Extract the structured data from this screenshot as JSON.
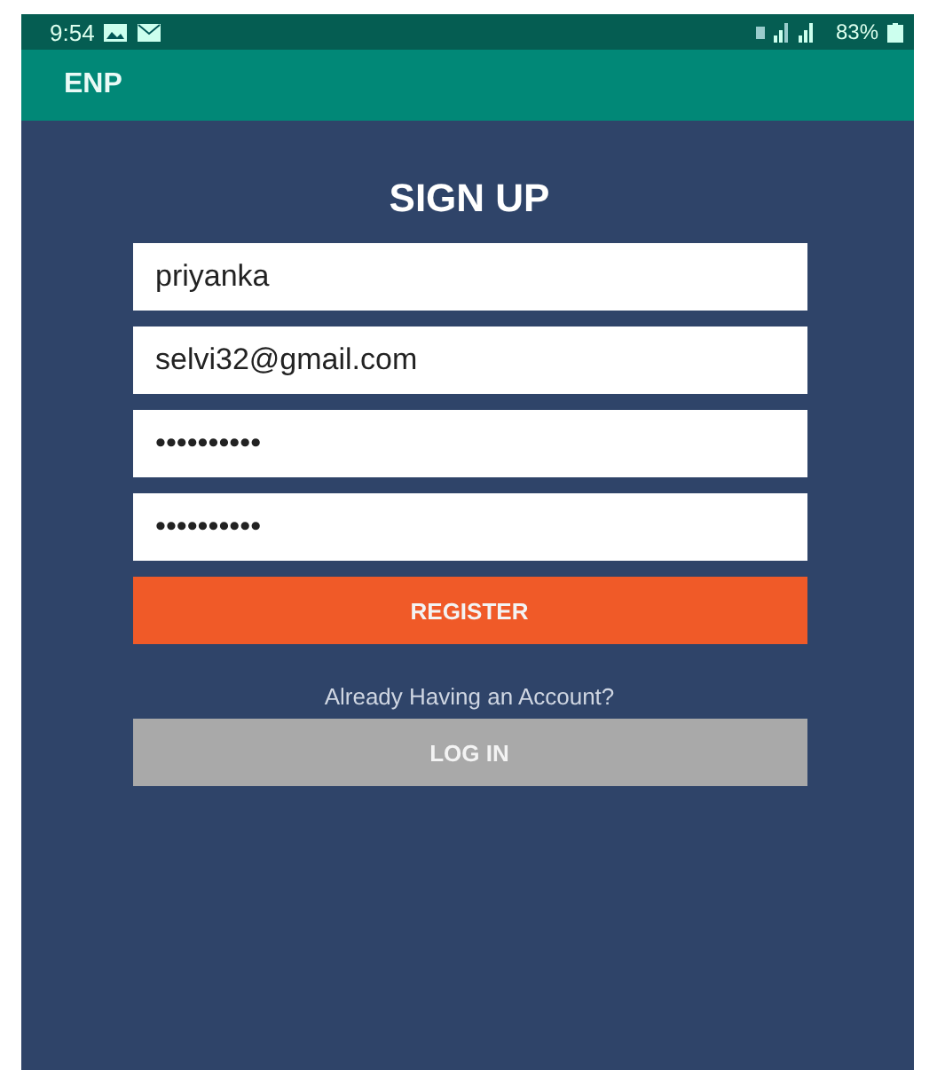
{
  "status_bar": {
    "time": "9:54",
    "battery": "83%"
  },
  "app_bar": {
    "title": "ENP"
  },
  "form": {
    "title": "SIGN UP",
    "fields": [
      {
        "value": "priyanka"
      },
      {
        "value": "selvi32@gmail.com"
      },
      {
        "value": "••••••••••"
      },
      {
        "value": "••••••••••"
      }
    ],
    "register_button": "REGISTER",
    "prompt": "Already Having an Account?",
    "login_button": "LOG IN"
  }
}
